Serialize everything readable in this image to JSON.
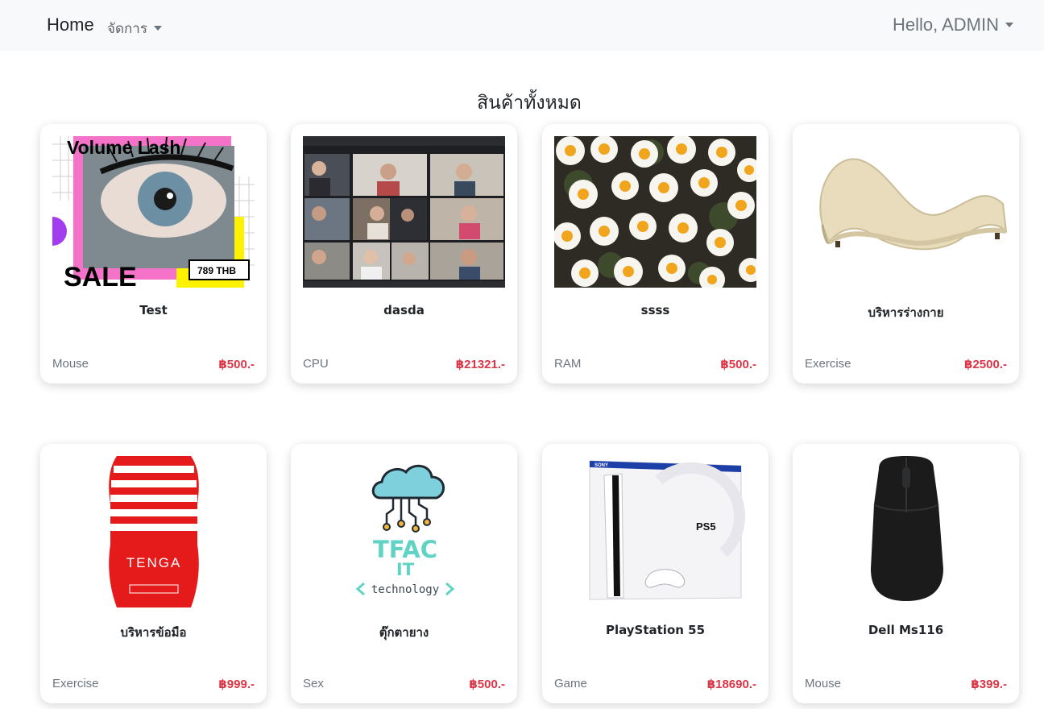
{
  "nav": {
    "brand": "Home",
    "manage_label": "จัดการ",
    "user_label": "Hello, ADMIN"
  },
  "page": {
    "title": "สินค้าทั้งหมด"
  },
  "products": [
    {
      "name": "Test",
      "category": "Mouse",
      "price": "฿500.-",
      "image": "volume-lash-ad",
      "image_text": {
        "headline": "Volume Lash",
        "sale": "SALE",
        "tag": "789 THB"
      }
    },
    {
      "name": "dasda",
      "category": "CPU",
      "price": "฿21321.-",
      "image": "video-call-grid"
    },
    {
      "name": "ssss",
      "category": "RAM",
      "price": "฿500.-",
      "image": "daisy-flowers"
    },
    {
      "name": "บริหารร่างกาย",
      "category": "Exercise",
      "price": "฿2500.-",
      "image": "beige-curved-chaise"
    },
    {
      "name": "บริหารข้อมือ",
      "category": "Exercise",
      "price": "฿999.-",
      "image": "red-white-cup-product",
      "image_text": {
        "brand": "TENGA"
      }
    },
    {
      "name": "ตุ๊กตายาง",
      "category": "Sex",
      "price": "฿500.-",
      "image": "tfac-it-logo",
      "image_text": {
        "line1": "TFAC",
        "line2": "IT",
        "line3": "technology"
      }
    },
    {
      "name": "PlayStation 55",
      "category": "Game",
      "price": "฿18690.-",
      "image": "ps5-box",
      "image_text": {
        "maker": "SONY",
        "console": "PS5"
      }
    },
    {
      "name": "Dell Ms116",
      "category": "Mouse",
      "price": "฿399.-",
      "image": "black-mouse"
    }
  ]
}
